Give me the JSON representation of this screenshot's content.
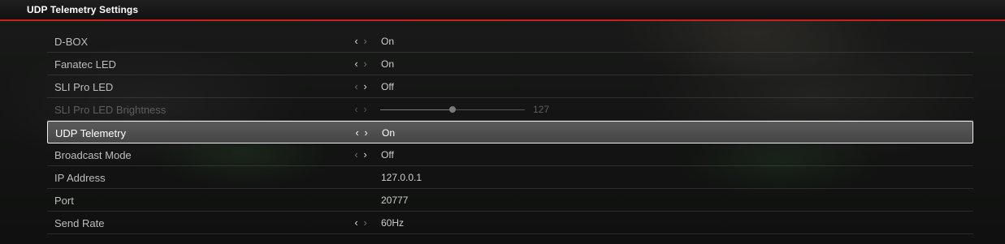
{
  "header": {
    "title": "UDP Telemetry Settings"
  },
  "settings": [
    {
      "label": "D-BOX",
      "value": "On"
    },
    {
      "label": "Fanatec LED",
      "value": "On"
    },
    {
      "label": "SLI Pro LED",
      "value": "Off"
    },
    {
      "label": "SLI Pro LED Brightness",
      "value": "127",
      "slider_fraction": 0.5
    },
    {
      "label": "UDP Telemetry",
      "value": "On"
    },
    {
      "label": "Broadcast Mode",
      "value": "Off"
    },
    {
      "label": "IP Address",
      "value": "127.0.0.1"
    },
    {
      "label": "Port",
      "value": "20777"
    },
    {
      "label": "Send Rate",
      "value": "60Hz"
    }
  ],
  "icons": {
    "left": "chevron-left-icon",
    "right": "chevron-right-icon"
  },
  "colors": {
    "accent": "#c8201c",
    "selected_border": "#f0f0f0"
  }
}
